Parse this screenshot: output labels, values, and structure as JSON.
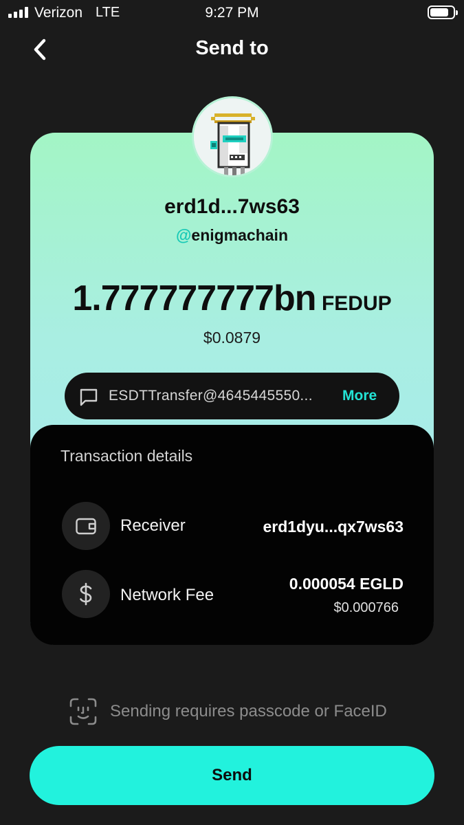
{
  "status_bar": {
    "carrier": "Verizon",
    "network": "LTE",
    "time": "9:27 PM",
    "signal_bars": 4
  },
  "header": {
    "title": "Send to",
    "back_icon": "chevron-left-icon"
  },
  "recipient": {
    "address_short": "erd1d...7ws63",
    "handle_prefix": "@",
    "handle": "enigmachain"
  },
  "amount": {
    "value": "1.777777777bn",
    "token": "FEDUP",
    "usd": "$0.0879"
  },
  "data_field": {
    "icon": "message-square-icon",
    "text": "ESDTTransfer@4645445550...",
    "more_label": "More"
  },
  "transaction_details": {
    "title": "Transaction details",
    "receiver": {
      "icon": "wallet-icon",
      "label": "Receiver",
      "value": "erd1dyu...qx7ws63"
    },
    "network_fee": {
      "icon": "dollar-icon",
      "label": "Network Fee",
      "value": "0.000054 EGLD",
      "usd": "$0.000766"
    }
  },
  "footer": {
    "faceid_icon": "face-id-icon",
    "note": "Sending requires passcode or FaceID",
    "send_label": "Send"
  },
  "colors": {
    "accent": "#22f2dd",
    "background": "#1b1b1b",
    "card_gradient_top": "#a3f5c5",
    "card_gradient_bottom": "#a6e9f4",
    "panel": "#030303"
  }
}
